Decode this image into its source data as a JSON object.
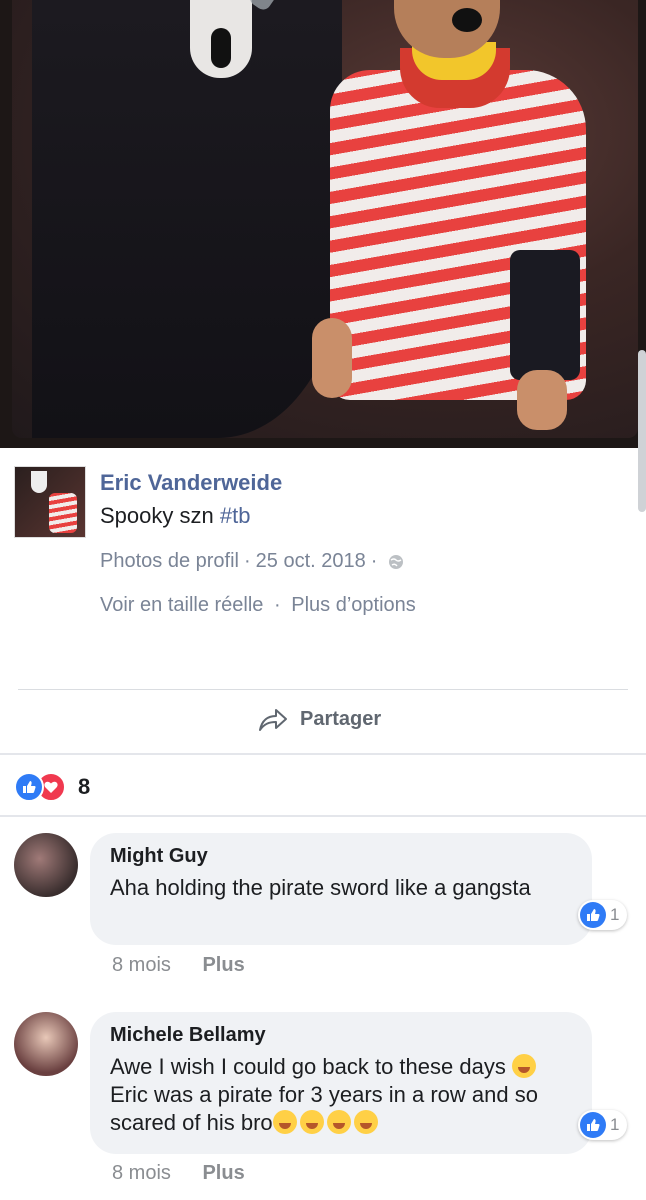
{
  "post": {
    "author": "Eric Vanderweide",
    "caption_text": "Spooky szn ",
    "caption_hashtag": "#tb",
    "album": "Photos de profil",
    "date": "25 oct. 2018",
    "sep": "·",
    "view_full": "Voir en taille réelle",
    "more_options": "Plus d’options"
  },
  "actions": {
    "share_label": "Partager"
  },
  "reactions": {
    "count": "8"
  },
  "comments": [
    {
      "author": "Might Guy",
      "text": "Aha holding the pirate sword like a gangsta",
      "likes": "1",
      "time": "8 mois",
      "more": "Plus"
    },
    {
      "author": "Michele Bellamy",
      "text_a": "Awe I wish I could go back to these days ",
      "text_b": " Eric was a pirate for 3 years in a row and so scared of his bro",
      "likes": "1",
      "time": "8 mois",
      "more": "Plus"
    }
  ],
  "colors": {
    "link": "#4f6698",
    "like_blue": "#2f7bf6",
    "love_red": "#f0394f"
  }
}
